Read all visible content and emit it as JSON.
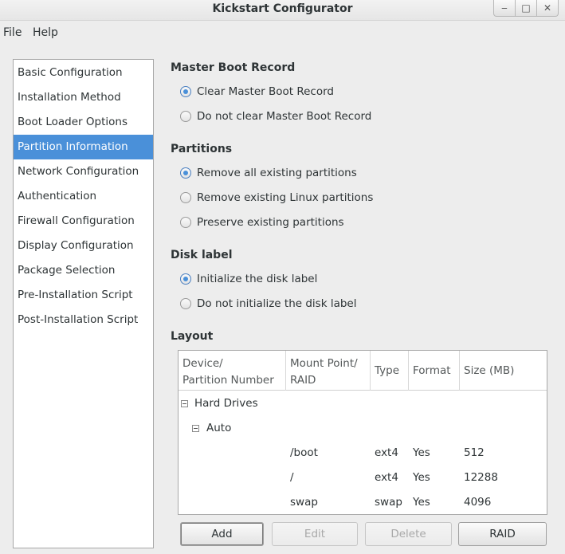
{
  "window": {
    "title": "Kickstart Configurator",
    "controls": {
      "minimize": "‒",
      "maximize": "□",
      "close": "✕"
    }
  },
  "menubar": {
    "file": "File",
    "help": "Help"
  },
  "sidebar": {
    "items": [
      {
        "label": "Basic Configuration",
        "selected": false
      },
      {
        "label": "Installation Method",
        "selected": false
      },
      {
        "label": "Boot Loader Options",
        "selected": false
      },
      {
        "label": "Partition Information",
        "selected": true
      },
      {
        "label": "Network Configuration",
        "selected": false
      },
      {
        "label": "Authentication",
        "selected": false
      },
      {
        "label": "Firewall Configuration",
        "selected": false
      },
      {
        "label": "Display Configuration",
        "selected": false
      },
      {
        "label": "Package Selection",
        "selected": false
      },
      {
        "label": "Pre-Installation Script",
        "selected": false
      },
      {
        "label": "Post-Installation Script",
        "selected": false
      }
    ],
    "selected_color": "#4a90d9"
  },
  "mbr": {
    "title": "Master Boot Record",
    "options": [
      {
        "label": "Clear Master Boot Record",
        "checked": true
      },
      {
        "label": "Do not clear Master Boot Record",
        "checked": false
      }
    ]
  },
  "partitions": {
    "title": "Partitions",
    "options": [
      {
        "label": "Remove all existing partitions",
        "checked": true
      },
      {
        "label": "Remove existing Linux partitions",
        "checked": false
      },
      {
        "label": "Preserve existing partitions",
        "checked": false
      }
    ]
  },
  "disklabel": {
    "title": "Disk label",
    "options": [
      {
        "label": "Initialize the disk label",
        "checked": true
      },
      {
        "label": "Do not initialize the disk label",
        "checked": false
      }
    ]
  },
  "layout": {
    "title": "Layout",
    "columns": {
      "device_l1": "Device/",
      "device_l2": "Partition Number",
      "mount_l1": "Mount Point/",
      "mount_l2": "RAID",
      "type": "Type",
      "format": "Format",
      "size": "Size (MB)"
    },
    "tree": {
      "hard_drives": "Hard Drives",
      "auto": "Auto"
    },
    "rows": [
      {
        "mount": "/boot",
        "type": "ext4",
        "format": "Yes",
        "size": "512"
      },
      {
        "mount": "/",
        "type": "ext4",
        "format": "Yes",
        "size": "12288"
      },
      {
        "mount": "swap",
        "type": "swap",
        "format": "Yes",
        "size": "4096"
      }
    ]
  },
  "buttons": {
    "add": "Add",
    "edit": "Edit",
    "delete": "Delete",
    "raid": "RAID"
  }
}
